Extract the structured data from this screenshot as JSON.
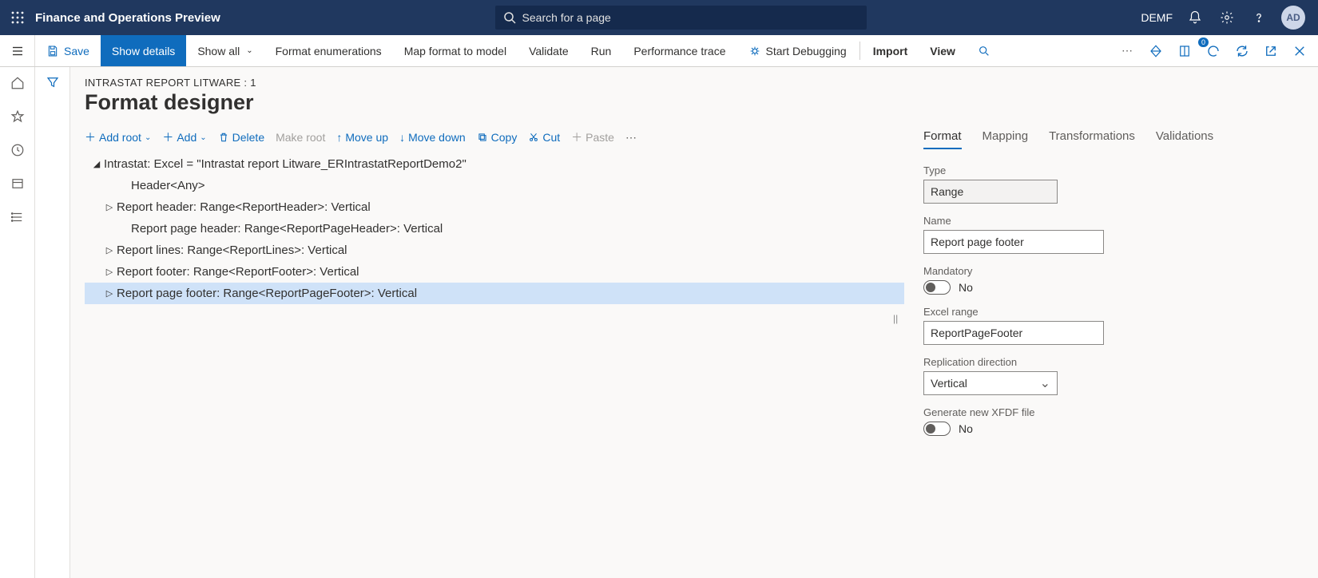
{
  "header": {
    "app_title": "Finance and Operations Preview",
    "search_placeholder": "Search for a page",
    "company": "DEMF",
    "avatar_initials": "AD"
  },
  "action_bar": {
    "save": "Save",
    "show_details": "Show details",
    "show_all": "Show all",
    "format_enum": "Format enumerations",
    "map_format": "Map format to model",
    "validate": "Validate",
    "run": "Run",
    "perf_trace": "Performance trace",
    "start_debug": "Start Debugging",
    "import": "Import",
    "view": "View",
    "badge": "0"
  },
  "page": {
    "breadcrumb": "INTRASTAT REPORT LITWARE : 1",
    "title": "Format designer"
  },
  "tree_toolbar": {
    "add_root": "Add root",
    "add": "Add",
    "delete": "Delete",
    "make_root": "Make root",
    "move_up": "Move up",
    "move_down": "Move down",
    "copy": "Copy",
    "cut": "Cut",
    "paste": "Paste"
  },
  "tree": {
    "root": "Intrastat: Excel = \"Intrastat report Litware_ERIntrastatReportDemo2\"",
    "n1": "Header<Any>",
    "n2": "Report header: Range<ReportHeader>: Vertical",
    "n3": "Report page header: Range<ReportPageHeader>: Vertical",
    "n4": "Report lines: Range<ReportLines>: Vertical",
    "n5": "Report footer: Range<ReportFooter>: Vertical",
    "n6": "Report page footer: Range<ReportPageFooter>: Vertical"
  },
  "tabs": {
    "format": "Format",
    "mapping": "Mapping",
    "transformations": "Transformations",
    "validations": "Validations"
  },
  "props": {
    "type_label": "Type",
    "type_value": "Range",
    "name_label": "Name",
    "name_value": "Report page footer",
    "mandatory_label": "Mandatory",
    "mandatory_value": "No",
    "excel_range_label": "Excel range",
    "excel_range_value": "ReportPageFooter",
    "replication_label": "Replication direction",
    "replication_value": "Vertical",
    "xfdf_label": "Generate new XFDF file",
    "xfdf_value": "No"
  }
}
